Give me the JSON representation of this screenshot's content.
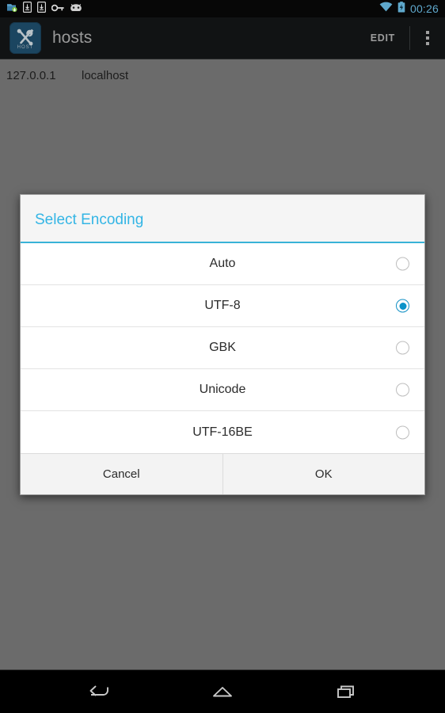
{
  "status_bar": {
    "icons": [
      {
        "name": "app-update-icon"
      },
      {
        "name": "download-icon-1"
      },
      {
        "name": "download-icon-2"
      },
      {
        "name": "vpn-key-icon"
      },
      {
        "name": "cyanogenmod-icon"
      }
    ],
    "wifi_icon": "wifi-icon",
    "battery_icon": "battery-charging-icon",
    "time": "00:26"
  },
  "action_bar": {
    "app_icon": "hosts-app-icon",
    "app_icon_label": "HOST",
    "title": "hosts",
    "edit_label": "EDIT",
    "overflow_icon": "overflow-menu-icon"
  },
  "content": {
    "host_entry": {
      "ip": "127.0.0.1",
      "hostname": "localhost"
    }
  },
  "dialog": {
    "title": "Select Encoding",
    "title_color": "#33b5e5",
    "accent_color": "#33b5e5",
    "options": [
      {
        "label": "Auto",
        "selected": false
      },
      {
        "label": "UTF-8",
        "selected": true
      },
      {
        "label": "GBK",
        "selected": false
      },
      {
        "label": "Unicode",
        "selected": false
      },
      {
        "label": "UTF-16BE",
        "selected": false
      }
    ],
    "cancel_label": "Cancel",
    "ok_label": "OK"
  },
  "nav_bar": {
    "back_icon": "back-icon",
    "home_icon": "home-icon",
    "recents_icon": "recent-apps-icon"
  }
}
